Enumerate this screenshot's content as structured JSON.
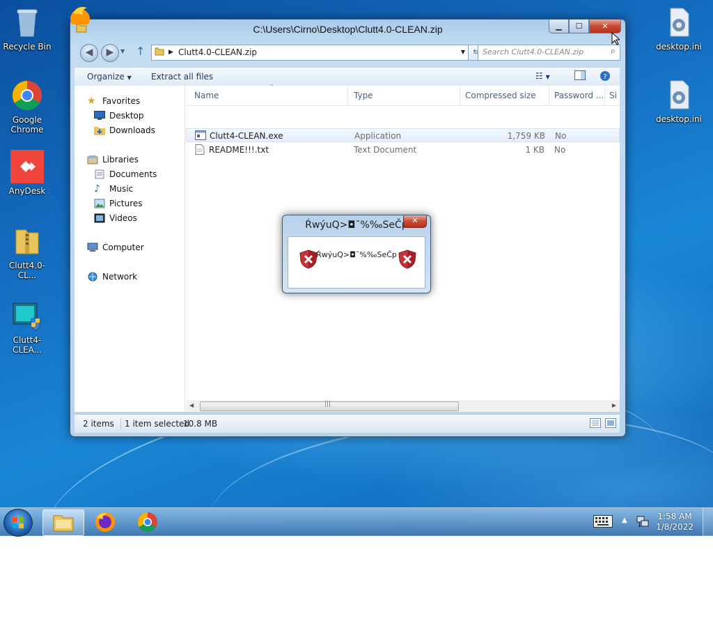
{
  "desktop": {
    "icons_left": [
      {
        "label": "Recycle Bin",
        "icon": "recycle-bin-icon"
      },
      {
        "label": "Google\nChrome",
        "icon": "chrome-icon"
      },
      {
        "label": "AnyDesk",
        "icon": "anydesk-icon"
      },
      {
        "label": "Clutt4.0-CL...",
        "icon": "zip-folder-icon"
      },
      {
        "label": "Clutt4-CLEA...",
        "icon": "installer-icon"
      }
    ],
    "icons_right": [
      {
        "label": "desktop.ini",
        "icon": "ini-file-icon"
      },
      {
        "label": "desktop.ini",
        "icon": "ini-file-icon"
      }
    ]
  },
  "window": {
    "title": "C:\\Users\\Cirno\\Desktop\\Clutt4.0-CLEAN.zip",
    "address": "Clutt4.0-CLEAN.zip",
    "search_placeholder": "Search Clutt4.0-CLEAN.zip",
    "toolbar": {
      "organize": "Organize",
      "extract": "Extract all files"
    },
    "nav": {
      "favorites": "Favorites",
      "desktop": "Desktop",
      "downloads": "Downloads",
      "libraries": "Libraries",
      "documents": "Documents",
      "music": "Music",
      "pictures": "Pictures",
      "videos": "Videos",
      "computer": "Computer",
      "network": "Network"
    },
    "columns": {
      "name": "Name",
      "type": "Type",
      "compressed": "Compressed size",
      "password": "Password ...",
      "size": "Si"
    },
    "files": [
      {
        "name": "Clutt4-CLEAN.exe",
        "type": "Application",
        "compressed": "1,759 KB",
        "password": "No"
      },
      {
        "name": "README!!!.txt",
        "type": "Text Document",
        "compressed": "1 KB",
        "password": "No"
      }
    ],
    "status": {
      "count": "2 items",
      "selected": "1 item selected",
      "size": "10.8 MB"
    }
  },
  "dialog": {
    "title": "ŔwýuQ>◘˘%‰SeČp",
    "message": "ŔwýuQ>◘˘%‰SeČp"
  },
  "taskbar": {
    "time": "1:58 AM",
    "date": "1/8/2022"
  }
}
